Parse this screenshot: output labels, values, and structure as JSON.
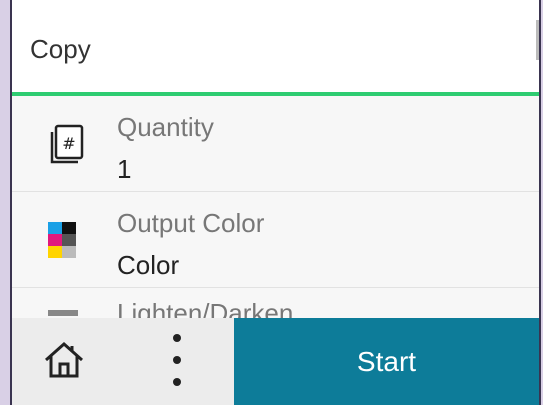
{
  "header": {
    "title": "Copy"
  },
  "settings": [
    {
      "label": "Quantity",
      "value": "1",
      "icon": "copies-icon"
    },
    {
      "label": "Output Color",
      "value": "Color",
      "icon": "color-swatch-icon"
    },
    {
      "label": "Lighten/Darken",
      "value": "",
      "icon": "lighten-darken-icon"
    }
  ],
  "footer": {
    "start_label": "Start",
    "home_icon": "home-icon",
    "more_icon": "more-options-icon"
  },
  "colors": {
    "accent_line": "#2ecc71",
    "start_button": "#0d7c99"
  }
}
